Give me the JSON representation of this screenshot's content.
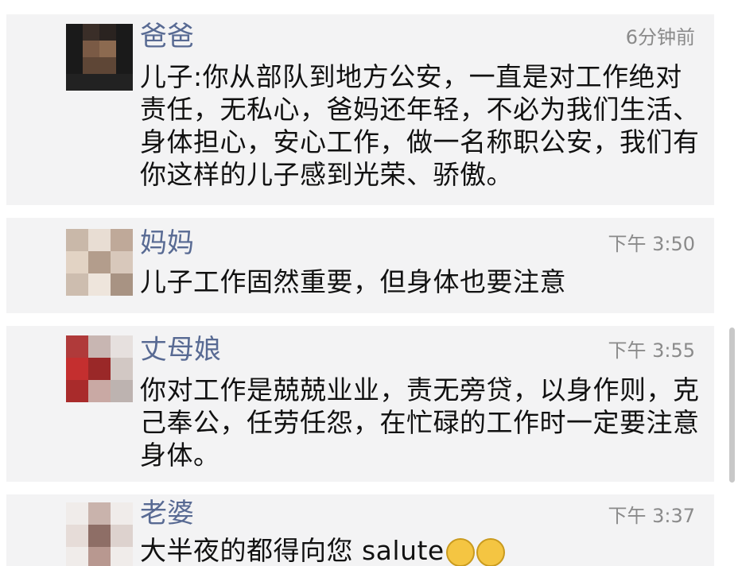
{
  "messages": [
    {
      "name": "爸爸",
      "time": "6分钟前",
      "text": "儿子:你从部队到地方公安，一直是对工作绝对责任，无私心，爸妈还年轻，不必为我们生活、身体担心，安心工作，做一名称职公安，我们有你这样的儿子感到光荣、骄傲。"
    },
    {
      "name": "妈妈",
      "time": "下午 3:50",
      "text": "儿子工作固然重要，但身体也要注意"
    },
    {
      "name": "丈母娘",
      "time": "下午 3:55",
      "text": "你对工作是兢兢业业，责无旁贷，以身作则，克己奉公，任劳任怨，在忙碌的工作时一定要注意身体。"
    },
    {
      "name": "老婆",
      "time": "下午 3:37",
      "text": "大半夜的都得向您 salute"
    }
  ],
  "colors": {
    "name": "#586a93",
    "card_bg": "#f3f3f4",
    "time": "#8a8a8a"
  },
  "icons": [
    "blurred-avatar",
    "thinking-emoji"
  ]
}
